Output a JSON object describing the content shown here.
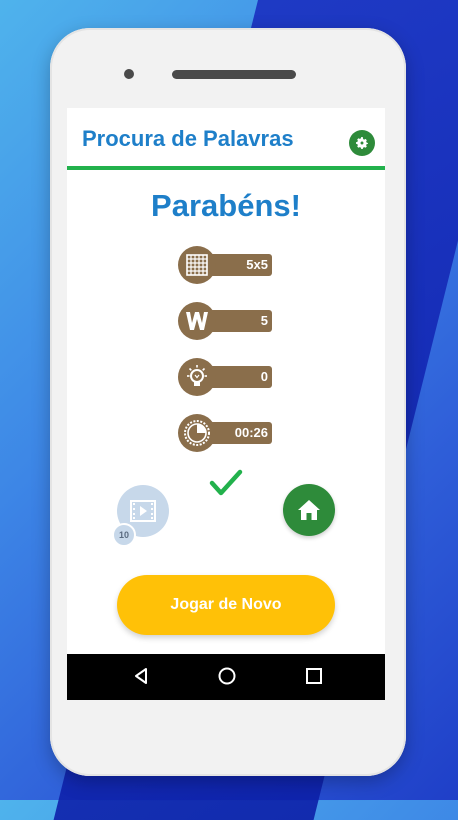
{
  "app": {
    "title": "Procura de Palavras",
    "accent_color": "#1e7fc9",
    "divider_color": "#22b14c"
  },
  "result": {
    "heading": "Parabéns!"
  },
  "stats": [
    {
      "icon": "grid-icon",
      "value": "5x5"
    },
    {
      "icon": "w-letter-icon",
      "value": "5"
    },
    {
      "icon": "lightbulb-icon",
      "value": "0"
    },
    {
      "icon": "timer-icon",
      "value": "00:26"
    }
  ],
  "actions": {
    "video_badge_count": "10",
    "play_again_label": "Jogar de Novo"
  }
}
